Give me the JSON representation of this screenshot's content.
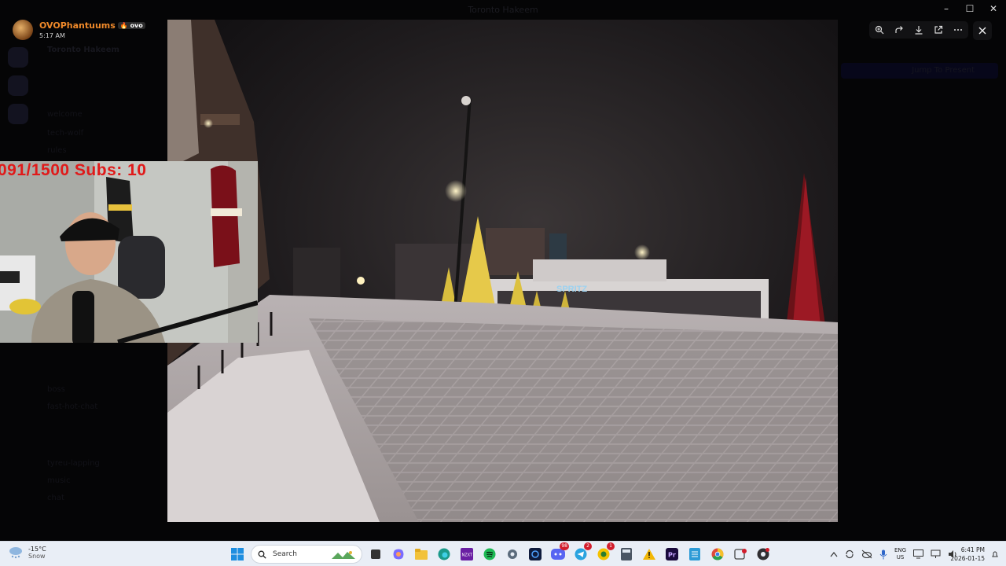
{
  "background": {
    "window_title": "Toronto Hakeem",
    "server_name": "Toronto Hakeem",
    "channels": [
      "welcome",
      "tech-wolf",
      "rules",
      "boss",
      "fast-hot-chat",
      "tyreu-lapping",
      "music",
      "chat",
      "vibes"
    ],
    "jump_label": "Jump To Present"
  },
  "poster": {
    "name": "OVOPhantuums",
    "badge": "ovo",
    "time": "5:17 AM"
  },
  "viewer_toolbar": {
    "buttons": [
      "zoom-in-icon",
      "share-icon",
      "download-icon",
      "open-external-icon",
      "more-icon"
    ],
    "close_icon": "close-icon"
  },
  "webcam_overlay": {
    "counter_text": "091/1500  Subs: 10"
  },
  "photo": {
    "sign_text": "SPRITZ"
  },
  "taskbar": {
    "weather_temp": "-15°C",
    "weather_condition": "Snow",
    "search_placeholder": "Search",
    "badges": {
      "discord": "98",
      "telegram": "2",
      "messenger": "1"
    },
    "lang_line1": "ENG",
    "lang_line2": "US",
    "time": "6:41 PM",
    "date": "2026-01-15"
  },
  "colors": {
    "accent_orange": "#f08a2a",
    "counter_red": "#e01a1a",
    "taskbar_bg": "#e9eef6"
  }
}
